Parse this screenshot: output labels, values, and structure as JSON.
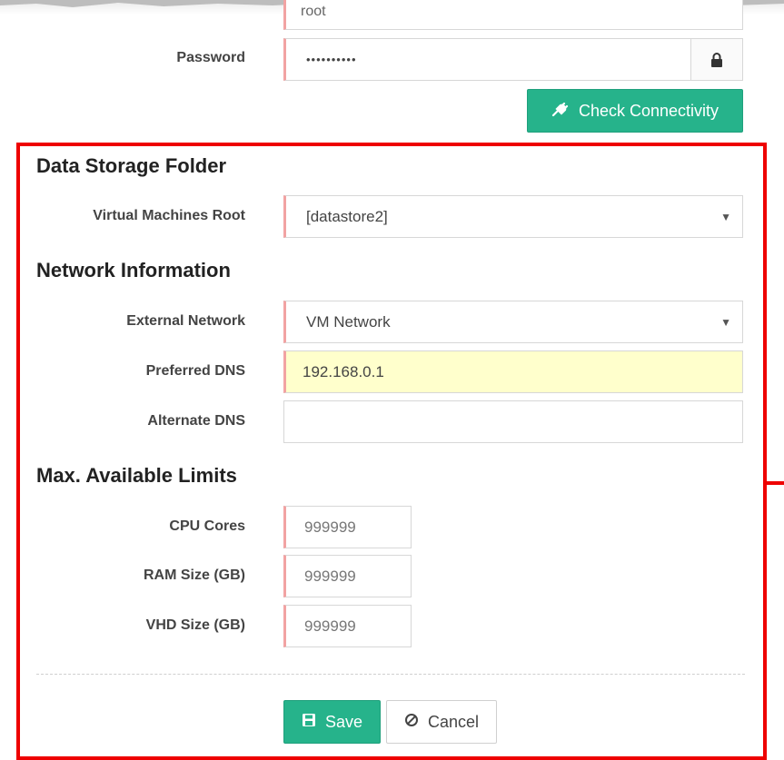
{
  "top_partial": {
    "username_value": "root"
  },
  "credentials": {
    "password_label": "Password",
    "password_value": "••••••••••",
    "check_button": "Check Connectivity"
  },
  "storage": {
    "title": "Data Storage Folder",
    "vm_root_label": "Virtual Machines Root",
    "vm_root_value": "[datastore2]"
  },
  "network": {
    "title": "Network Information",
    "external_label": "External Network",
    "external_value": "VM Network",
    "preferred_dns_label": "Preferred DNS",
    "preferred_dns_value": "192.168.0.1",
    "alternate_dns_label": "Alternate DNS",
    "alternate_dns_value": ""
  },
  "limits": {
    "title": "Max. Available Limits",
    "cpu_label": "CPU Cores",
    "cpu_value": "999999",
    "ram_label": "RAM Size (GB)",
    "ram_value": "999999",
    "vhd_label": "VHD Size (GB)",
    "vhd_value": "999999"
  },
  "actions": {
    "save": "Save",
    "cancel": "Cancel"
  },
  "colors": {
    "primary_button": "#26b38b",
    "required_marker": "#f2a3a3",
    "autofill_bg": "#ffffcc",
    "annotation_frame": "#ee0000"
  }
}
